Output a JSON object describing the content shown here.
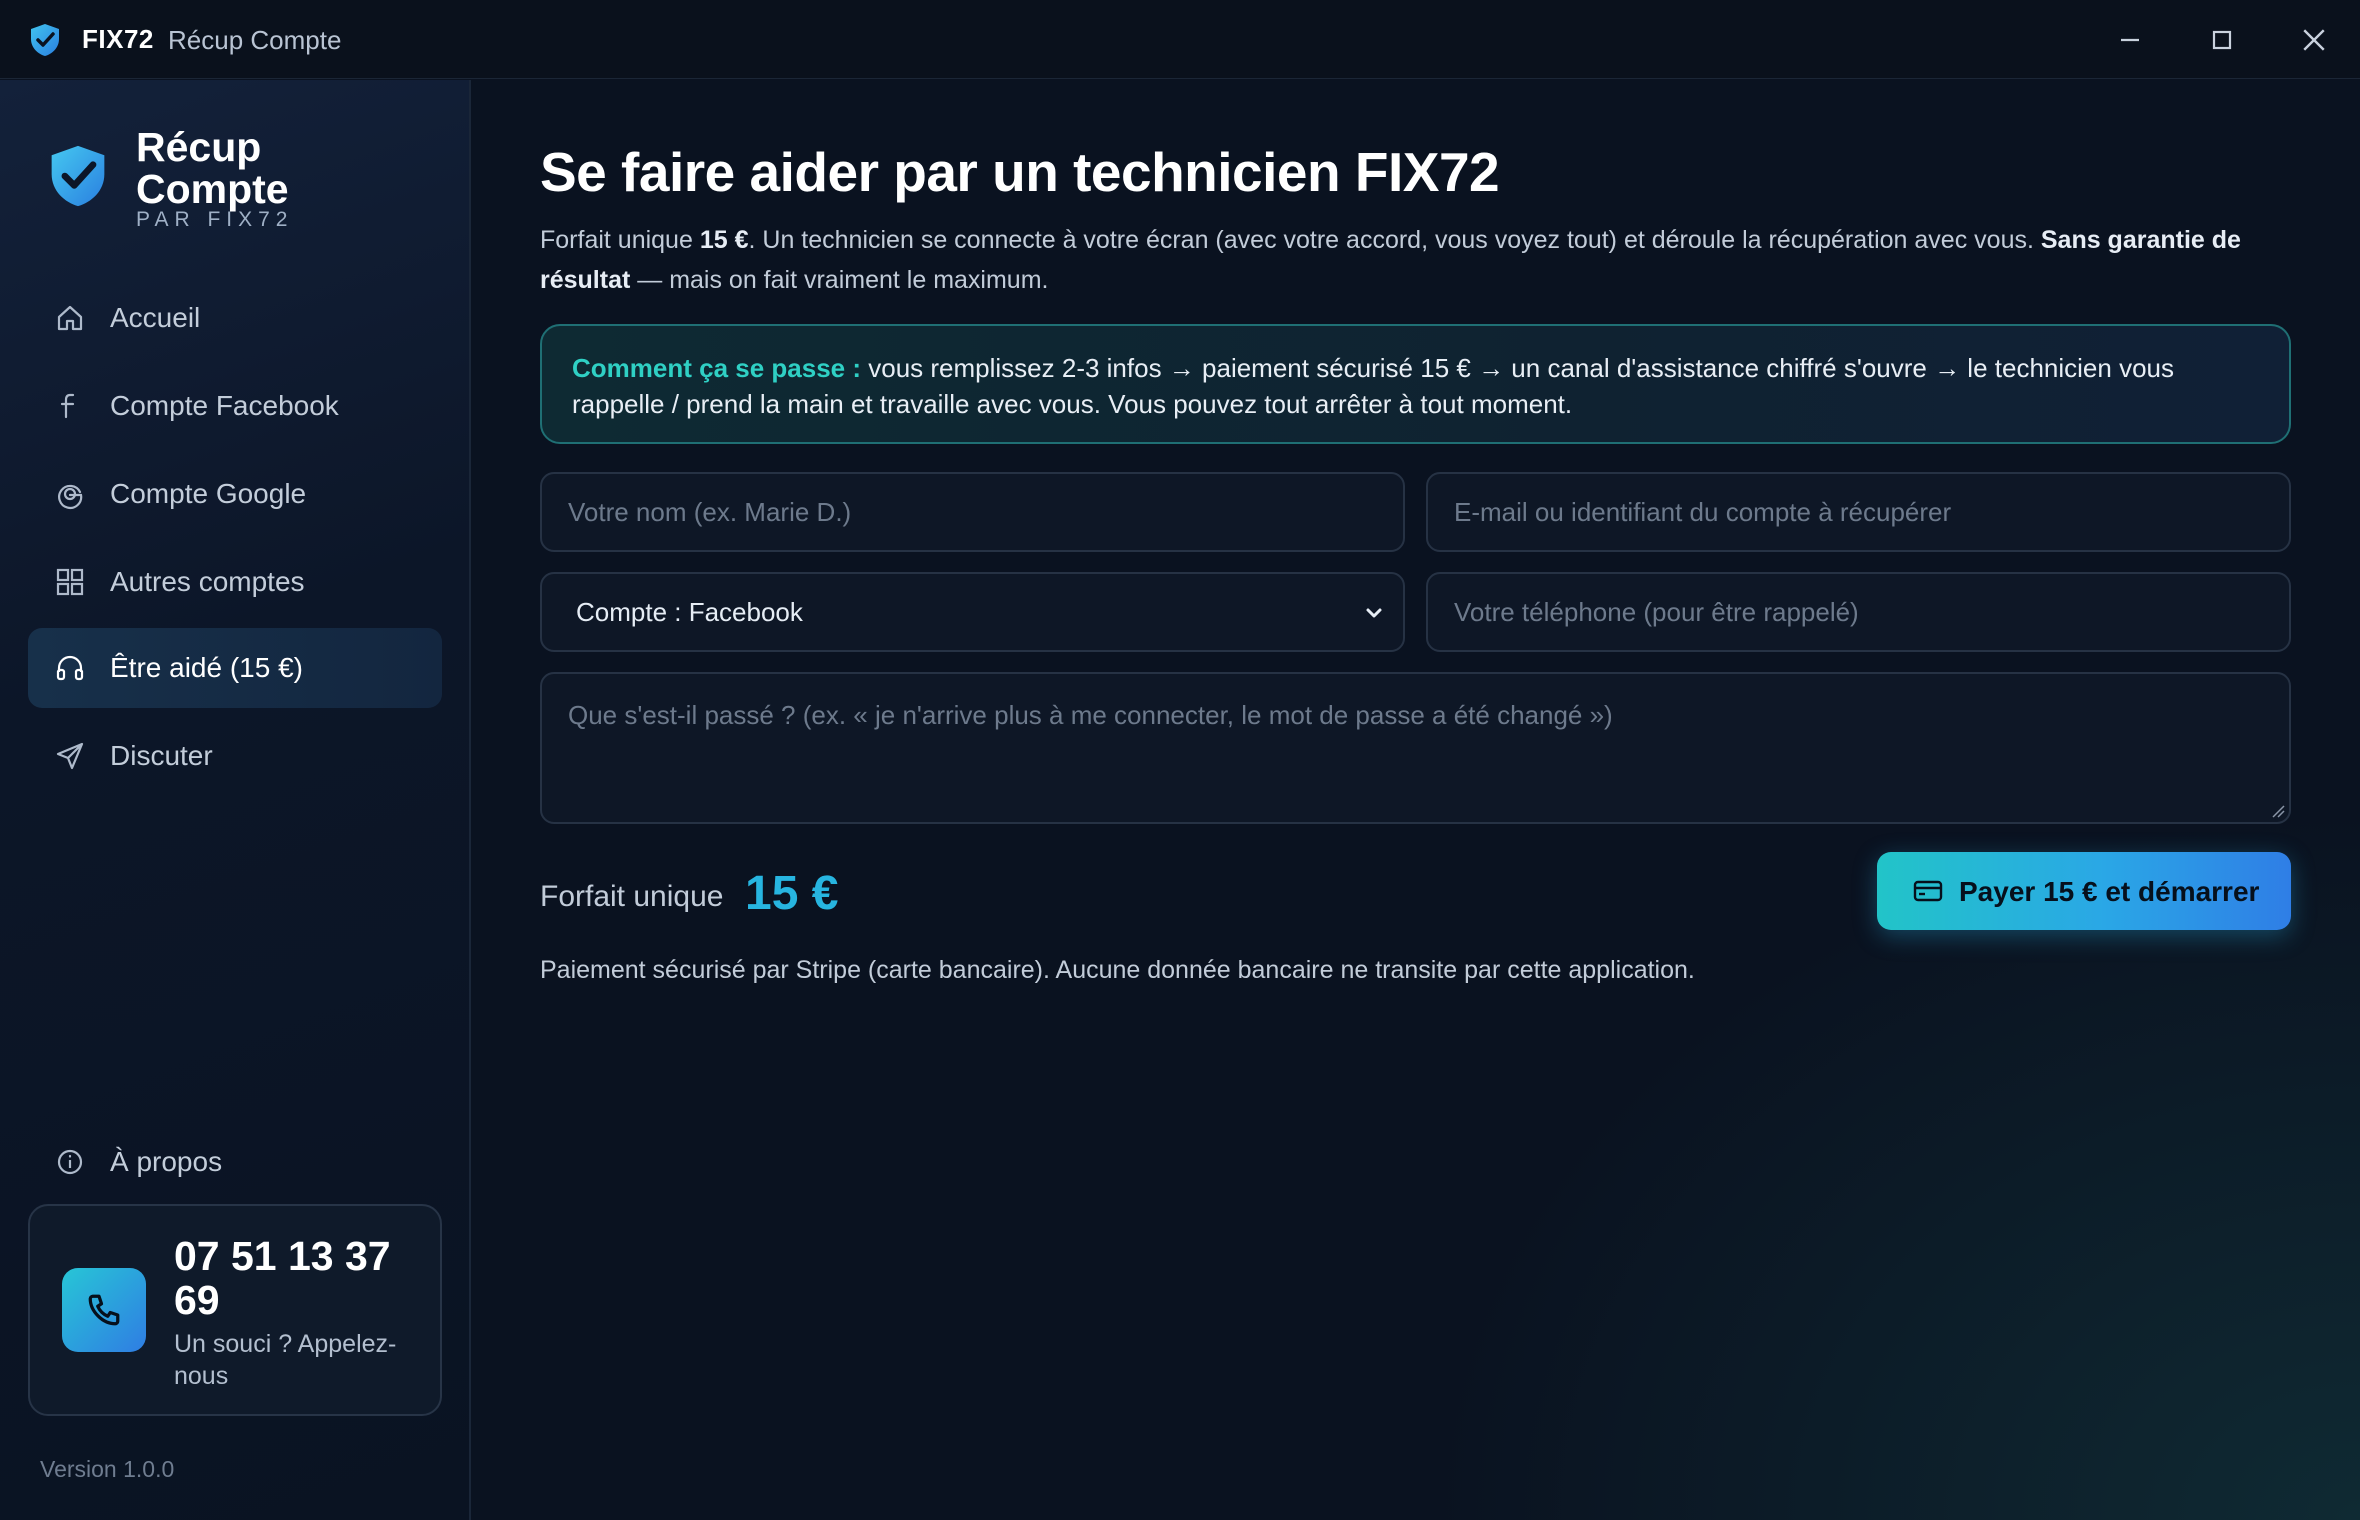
{
  "titlebar": {
    "brand": "FIX72",
    "app_name": "Récup Compte"
  },
  "sidebar": {
    "title_line1": "Récup",
    "title_line2": "Compte",
    "subtitle": "PAR FIX72",
    "items": [
      {
        "label": "Accueil",
        "icon": "home-icon"
      },
      {
        "label": "Compte Facebook",
        "icon": "facebook-icon"
      },
      {
        "label": "Compte Google",
        "icon": "google-icon"
      },
      {
        "label": "Autres comptes",
        "icon": "grid-icon"
      },
      {
        "label": "Être aidé (15 €)",
        "icon": "headset-icon",
        "active": true
      },
      {
        "label": "Discuter",
        "icon": "send-icon"
      }
    ],
    "about": {
      "label": "À propos",
      "icon": "info-icon"
    },
    "phone": {
      "number": "07 51 13 37 69",
      "caption": "Un souci ? Appelez-nous"
    },
    "version": "Version 1.0.0"
  },
  "main": {
    "title": "Se faire aider par un technicien FIX72",
    "intro": {
      "p1": "Forfait unique ",
      "price": "15 €",
      "p2": ". Un technicien se connecte à votre écran (avec votre accord, vous voyez tout) et déroule la récupération avec vous. ",
      "strong": "Sans garantie de résultat",
      "p3": " — mais on fait vraiment le maximum."
    },
    "how": {
      "label": "Comment ça se passe :",
      "text": " vous remplissez 2-3 infos → paiement sécurisé 15 € → un canal d'assistance chiffré s'ouvre → le technicien vous rappelle / prend la main et travaille avec vous. Vous pouvez tout arrêter à tout moment."
    },
    "form": {
      "name_placeholder": "Votre nom (ex. Marie D.)",
      "email_placeholder": "E-mail ou identifiant du compte à récupérer",
      "account_selected": "Compte : Facebook",
      "phone_placeholder": "Votre téléphone (pour être rappelé)",
      "message_placeholder": "Que s'est-il passé ? (ex. « je n'arrive plus à me connecter, le mot de passe a été changé »)"
    },
    "price_label": "Forfait unique",
    "price_value": "15 €",
    "pay_button": "Payer 15 € et démarrer",
    "stripe_note": "Paiement sécurisé par Stripe (carte bancaire). Aucune donnée bancaire ne transite par cette application."
  },
  "colors": {
    "accent_teal": "#2fd0c4",
    "accent_blue": "#27b5e0",
    "background": "#0a1220"
  }
}
